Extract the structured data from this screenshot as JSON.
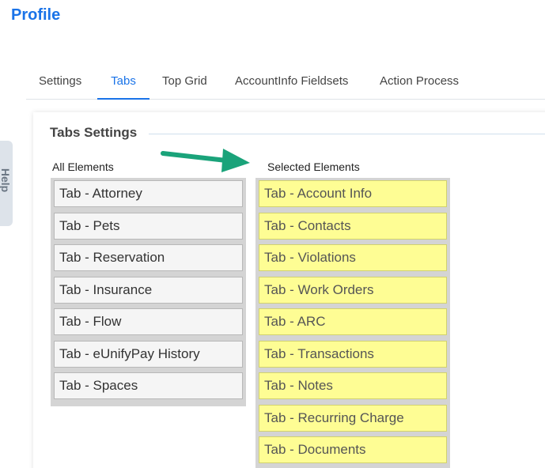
{
  "page": {
    "title": "Profile"
  },
  "tabs": [
    {
      "label": "Settings"
    },
    {
      "label": "Tabs"
    },
    {
      "label": "Top Grid"
    },
    {
      "label": "AccountInfo Fieldsets"
    },
    {
      "label": "Action Process"
    }
  ],
  "help": {
    "label": "Help"
  },
  "section": {
    "title": "Tabs Settings",
    "all_label": "All Elements",
    "selected_label": "Selected Elements"
  },
  "all_elements": [
    "Tab - Attorney",
    "Tab - Pets",
    "Tab - Reservation",
    "Tab - Insurance",
    "Tab - Flow",
    "Tab - eUnifyPay History",
    "Tab - Spaces"
  ],
  "selected_elements": [
    "Tab - Account Info",
    "Tab - Contacts",
    "Tab - Violations",
    "Tab - Work Orders",
    "Tab - ARC",
    "Tab - Transactions",
    "Tab - Notes",
    "Tab - Recurring Charge",
    "Tab - Documents"
  ],
  "colors": {
    "accent": "#1a73e8",
    "selected_item_bg": "#fefd94",
    "annotation_arrow": "#1aa37a"
  }
}
